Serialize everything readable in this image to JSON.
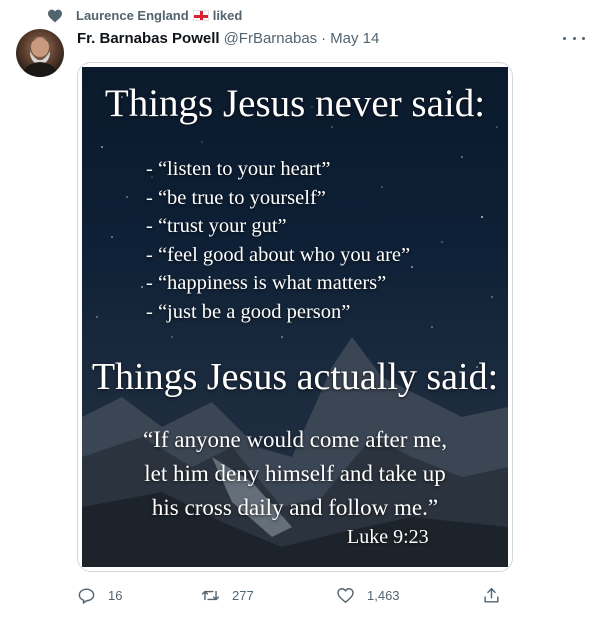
{
  "social_context": {
    "name": "Laurence England",
    "flag": "England flag",
    "action": "liked"
  },
  "tweet": {
    "author_name": "Fr. Barnabas Powell",
    "handle": "@FrBarnabas",
    "separator": "·",
    "date": "May 14"
  },
  "image_text": {
    "heading1": "Things Jesus never said:",
    "never_said": [
      "- “listen to your heart”",
      "- “be true to yourself”",
      "- “trust your gut”",
      "- “feel good about who you are”",
      "- “happiness is what matters”",
      "- “just be a good person”"
    ],
    "heading2": "Things Jesus actually said:",
    "quote_lines": [
      "“If anyone would come after me,",
      "let him deny himself and take up",
      "his cross daily and follow me.”"
    ],
    "reference": "Luke 9:23"
  },
  "actions": {
    "replies": "16",
    "retweets": "277",
    "likes": "1,463"
  },
  "colors": {
    "secondary_text": "#536471",
    "primary_text": "#0f1419",
    "border": "#cfd9de"
  },
  "icons": [
    "heart-icon",
    "more-icon",
    "reply-icon",
    "retweet-icon",
    "like-icon",
    "share-icon"
  ]
}
